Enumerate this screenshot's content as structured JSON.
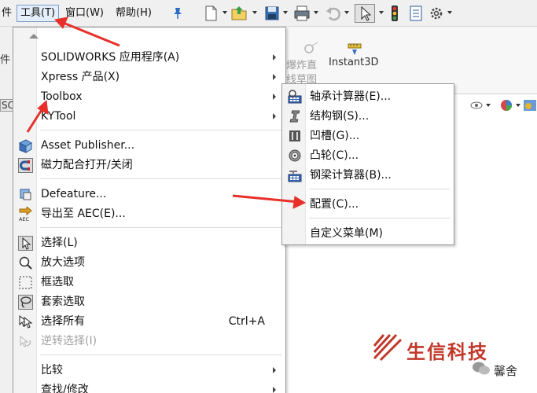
{
  "menubar": {
    "items": [
      {
        "label": "件"
      },
      {
        "label": "工具(T)",
        "active": true
      },
      {
        "label": "窗口(W)"
      },
      {
        "label": "帮助(H)"
      }
    ],
    "pin_icon": "pin-icon"
  },
  "toolbar": {
    "icons": [
      "new-file-icon",
      "open-folder-icon",
      "save-icon",
      "print-icon",
      "undo-icon",
      "select-arrow-icon",
      "traffic-light-icon",
      "file-properties-icon",
      "options-gear-icon"
    ]
  },
  "commandbar": {
    "exploded_label_1": "爆炸直",
    "exploded_label_2": "线草图",
    "instant3d_label": "Instant3D"
  },
  "left_partial": {
    "label": "件",
    "tab": "SC"
  },
  "tools_menu": {
    "items": [
      {
        "label": "SOLIDWORKS 应用程序(A)",
        "submenu": true
      },
      {
        "label": "Xpress 产品(X)",
        "submenu": true
      },
      {
        "label": "Toolbox",
        "submenu": true
      },
      {
        "label": "KYTool",
        "submenu": true
      },
      {
        "label": "Asset Publisher...",
        "icon": "asset-publisher-icon"
      },
      {
        "label": "磁力配合打开/关闭",
        "icon": "magnet-mate-icon"
      },
      {
        "label": "Defeature...",
        "icon": "defeature-icon"
      },
      {
        "label": "导出至 AEC(E)...",
        "icon": "export-aec-icon"
      },
      {
        "label": "选择(L)",
        "icon": "select-icon"
      },
      {
        "label": "放大选项",
        "icon": "magnify-select-icon"
      },
      {
        "label": "框选取",
        "icon": "box-select-icon"
      },
      {
        "label": "套索选取",
        "icon": "lasso-select-icon"
      },
      {
        "label": "选择所有",
        "icon": "select-all-icon",
        "shortcut": "Ctrl+A"
      },
      {
        "label": "逆转选择(I)",
        "icon": "invert-select-icon",
        "disabled": true
      },
      {
        "label": "比较",
        "submenu": true
      },
      {
        "label": "查找/修改",
        "submenu": true
      }
    ]
  },
  "toolbox_submenu": {
    "items": [
      {
        "label": "轴承计算器(E)...",
        "icon": "bearing-calculator-icon"
      },
      {
        "label": "结构钢(S)...",
        "icon": "structural-steel-icon"
      },
      {
        "label": "凹槽(G)...",
        "icon": "grooves-icon"
      },
      {
        "label": "凸轮(C)...",
        "icon": "cam-icon"
      },
      {
        "label": "钢梁计算器(B)...",
        "icon": "beam-calculator-icon"
      },
      {
        "label": "配置(C)..."
      },
      {
        "label": "自定义菜单(M)"
      }
    ]
  },
  "watermark": {
    "brand": "生信科技",
    "sub": "馨舍"
  },
  "colors": {
    "annotation_red": "#e8302a",
    "watermark_red": "#c0392b"
  }
}
